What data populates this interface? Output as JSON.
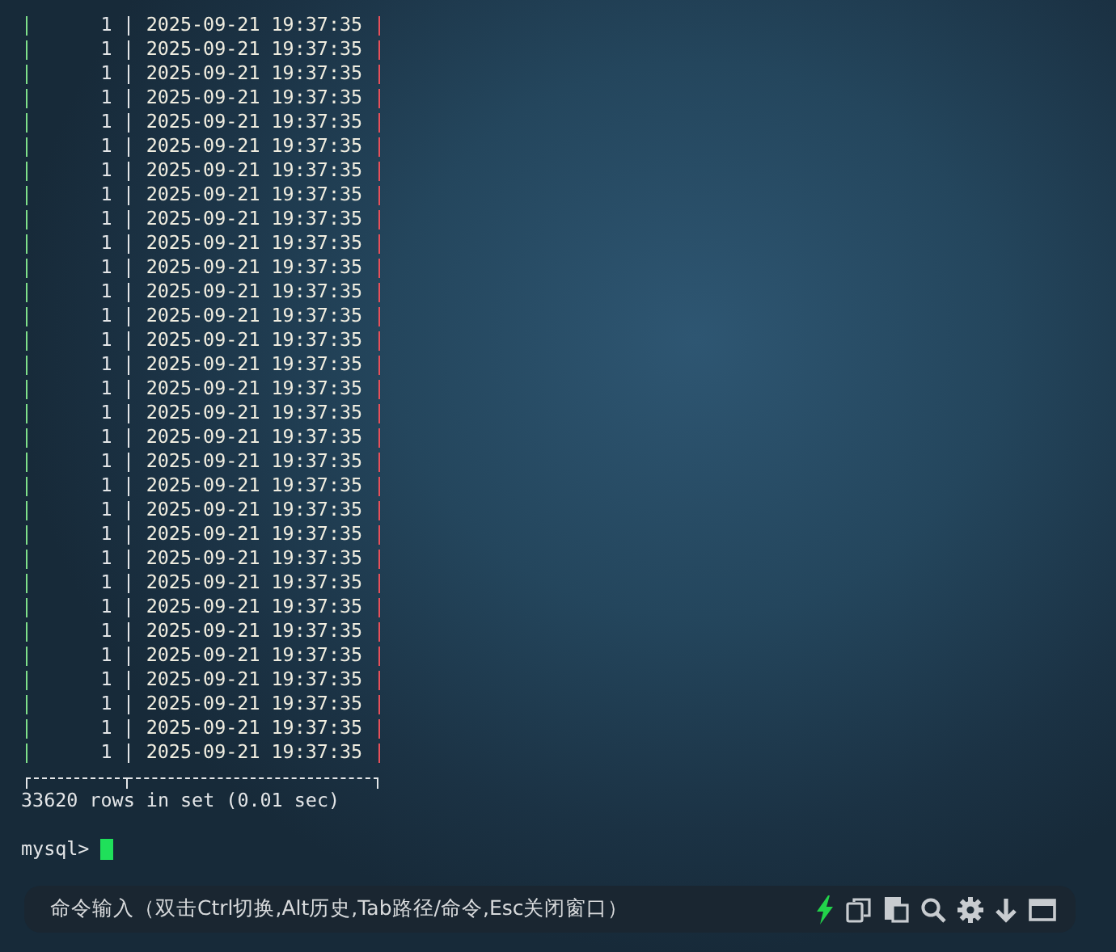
{
  "rows": [
    {
      "col_1": "1",
      "col_2": "2025-09-21 19:37:35"
    },
    {
      "col_1": "1",
      "col_2": "2025-09-21 19:37:35"
    },
    {
      "col_1": "1",
      "col_2": "2025-09-21 19:37:35"
    },
    {
      "col_1": "1",
      "col_2": "2025-09-21 19:37:35"
    },
    {
      "col_1": "1",
      "col_2": "2025-09-21 19:37:35"
    },
    {
      "col_1": "1",
      "col_2": "2025-09-21 19:37:35"
    },
    {
      "col_1": "1",
      "col_2": "2025-09-21 19:37:35"
    },
    {
      "col_1": "1",
      "col_2": "2025-09-21 19:37:35"
    },
    {
      "col_1": "1",
      "col_2": "2025-09-21 19:37:35"
    },
    {
      "col_1": "1",
      "col_2": "2025-09-21 19:37:35"
    },
    {
      "col_1": "1",
      "col_2": "2025-09-21 19:37:35"
    },
    {
      "col_1": "1",
      "col_2": "2025-09-21 19:37:35"
    },
    {
      "col_1": "1",
      "col_2": "2025-09-21 19:37:35"
    },
    {
      "col_1": "1",
      "col_2": "2025-09-21 19:37:35"
    },
    {
      "col_1": "1",
      "col_2": "2025-09-21 19:37:35"
    },
    {
      "col_1": "1",
      "col_2": "2025-09-21 19:37:35"
    },
    {
      "col_1": "1",
      "col_2": "2025-09-21 19:37:35"
    },
    {
      "col_1": "1",
      "col_2": "2025-09-21 19:37:35"
    },
    {
      "col_1": "1",
      "col_2": "2025-09-21 19:37:35"
    },
    {
      "col_1": "1",
      "col_2": "2025-09-21 19:37:35"
    },
    {
      "col_1": "1",
      "col_2": "2025-09-21 19:37:35"
    },
    {
      "col_1": "1",
      "col_2": "2025-09-21 19:37:35"
    },
    {
      "col_1": "1",
      "col_2": "2025-09-21 19:37:35"
    },
    {
      "col_1": "1",
      "col_2": "2025-09-21 19:37:35"
    },
    {
      "col_1": "1",
      "col_2": "2025-09-21 19:37:35"
    },
    {
      "col_1": "1",
      "col_2": "2025-09-21 19:37:35"
    },
    {
      "col_1": "1",
      "col_2": "2025-09-21 19:37:35"
    },
    {
      "col_1": "1",
      "col_2": "2025-09-21 19:37:35"
    },
    {
      "col_1": "1",
      "col_2": "2025-09-21 19:37:35"
    },
    {
      "col_1": "1",
      "col_2": "2025-09-21 19:37:35"
    },
    {
      "col_1": "1",
      "col_2": "2025-09-21 19:37:35"
    }
  ],
  "result_summary": "33620 rows in set (0.01 sec)",
  "prompt": "mysql>",
  "command_bar": {
    "hint": "命令输入（双击Ctrl切换,Alt历史,Tab路径/命令,Esc关闭窗口）"
  }
}
